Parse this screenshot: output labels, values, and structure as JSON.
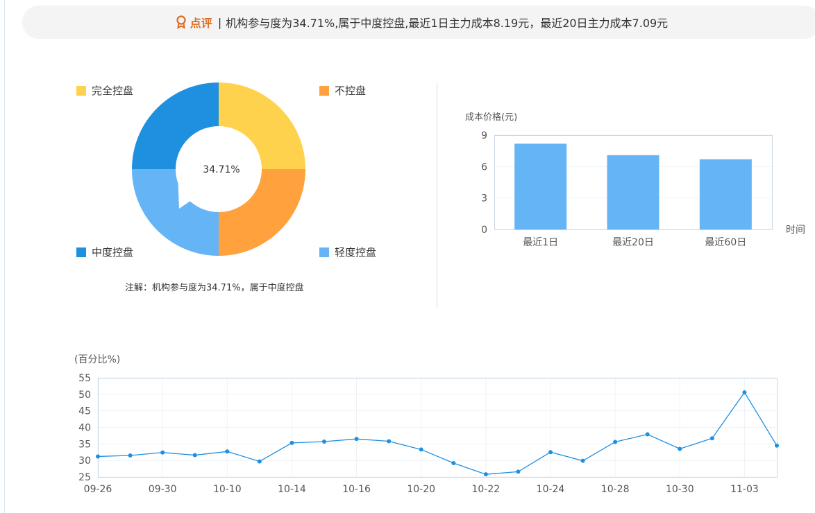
{
  "banner": {
    "label": "点评",
    "separator": "|",
    "text": "机构参与度为34.71%,属于中度控盘,最近1日主力成本8.19元，最近20日主力成本7.09元"
  },
  "colors": {
    "full_control": "#ffd24d",
    "no_control": "#ffa13d",
    "mid_control": "#1f8fe0",
    "light_control": "#64b4f6",
    "bar": "#64b4f6",
    "line": "#1f8fe0",
    "accent": "#e06a1b"
  },
  "chart_data": [
    {
      "type": "pie",
      "center_label": "34.71%",
      "legend": [
        "完全控盘",
        "不控盘",
        "中度控盘",
        "轻度控盘"
      ],
      "slices": [
        {
          "name": "完全控盘",
          "value": 25,
          "color": "#ffd24d"
        },
        {
          "name": "不控盘",
          "value": 25,
          "color": "#ffa13d"
        },
        {
          "name": "轻度控盘",
          "value": 25,
          "color": "#64b4f6"
        },
        {
          "name": "中度控盘",
          "value": 25,
          "color": "#1f8fe0"
        }
      ],
      "note": "注解：机构参与度为34.71%，属于中度控盘"
    },
    {
      "type": "bar",
      "ylabel": "成本价格(元)",
      "xlabel": "时间",
      "categories": [
        "最近1日",
        "最近20日",
        "最近60日"
      ],
      "values": [
        8.19,
        7.09,
        6.7
      ],
      "ylim": [
        0,
        9
      ],
      "yticks": [
        "0",
        "3",
        "6",
        "9"
      ],
      "grid": true
    },
    {
      "type": "line",
      "ylabel": "(百分比%)",
      "ylim": [
        25,
        55
      ],
      "yticks": [
        "25",
        "30",
        "35",
        "40",
        "45",
        "50",
        "55"
      ],
      "xticks": [
        "09-26",
        "09-30",
        "10-10",
        "10-14",
        "10-16",
        "10-20",
        "10-22",
        "10-24",
        "10-28",
        "10-30",
        "11-03"
      ],
      "values": [
        31.2,
        31.5,
        32.4,
        31.6,
        32.7,
        29.7,
        35.3,
        35.7,
        36.5,
        35.8,
        33.3,
        29.2,
        25.8,
        26.6,
        32.5,
        29.9,
        35.6,
        37.9,
        33.5,
        36.7,
        50.6,
        34.5
      ],
      "grid": true
    }
  ]
}
